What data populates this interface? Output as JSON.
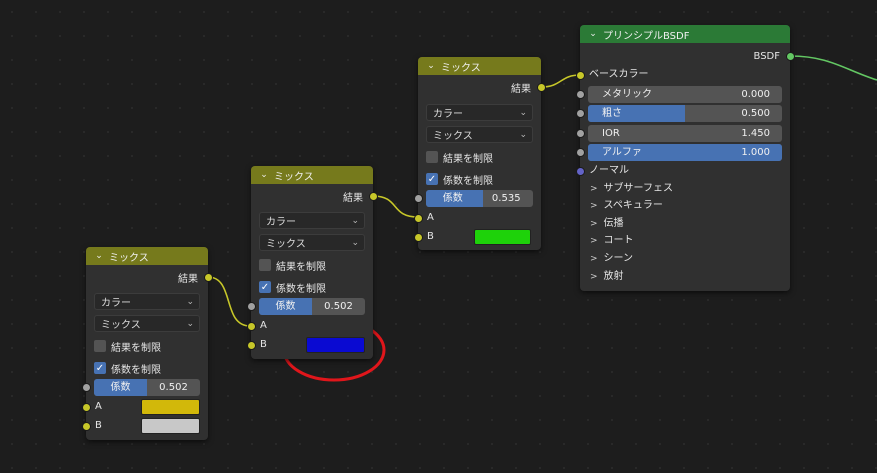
{
  "mix_nodes": [
    {
      "title": "ミックス",
      "output": "結果",
      "data_type": "カラー",
      "blend_mode": "ミックス",
      "clamp_result": {
        "label": "結果を制限",
        "checked": false
      },
      "clamp_factor": {
        "label": "係数を制限",
        "checked": true
      },
      "factor": {
        "label": "係数",
        "value": "0.502",
        "fraction": 0.502
      },
      "input_a": {
        "label": "A",
        "color": "#d2b80a"
      },
      "input_b": {
        "label": "B",
        "color": "#c8c8c8"
      }
    },
    {
      "title": "ミックス",
      "output": "結果",
      "data_type": "カラー",
      "blend_mode": "ミックス",
      "clamp_result": {
        "label": "結果を制限",
        "checked": false
      },
      "clamp_factor": {
        "label": "係数を制限",
        "checked": true
      },
      "factor": {
        "label": "係数",
        "value": "0.502",
        "fraction": 0.502
      },
      "input_a": {
        "label": "A"
      },
      "input_b": {
        "label": "B",
        "color": "#0a0ad2"
      }
    },
    {
      "title": "ミックス",
      "output": "結果",
      "data_type": "カラー",
      "blend_mode": "ミックス",
      "clamp_result": {
        "label": "結果を制限",
        "checked": false
      },
      "clamp_factor": {
        "label": "係数を制限",
        "checked": true
      },
      "factor": {
        "label": "係数",
        "value": "0.535",
        "fraction": 0.535
      },
      "input_a": {
        "label": "A"
      },
      "input_b": {
        "label": "B",
        "color": "#1ed20a"
      }
    }
  ],
  "bsdf": {
    "title": "プリンシプルBSDF",
    "output": "BSDF",
    "base_color": "ベースカラー",
    "metallic": {
      "label": "メタリック",
      "value": "0.000",
      "fraction": 0.0
    },
    "roughness": {
      "label": "粗さ",
      "value": "0.500",
      "fraction": 0.5
    },
    "ior": {
      "label": "IOR",
      "value": "1.450",
      "fraction": 0.0
    },
    "alpha": {
      "label": "アルファ",
      "value": "1.000",
      "fraction": 1.0
    },
    "normal": "ノーマル",
    "panels": [
      "サブサーフェス",
      "スペキュラー",
      "伝播",
      "コート",
      "シーン",
      "放射"
    ]
  },
  "annotation": {
    "color": "#e0161b"
  },
  "colors": {
    "mix_header": "#767a1c",
    "bsdf_header": "#2b7a36",
    "link": "#c7c729",
    "shader_link": "#63c763"
  }
}
